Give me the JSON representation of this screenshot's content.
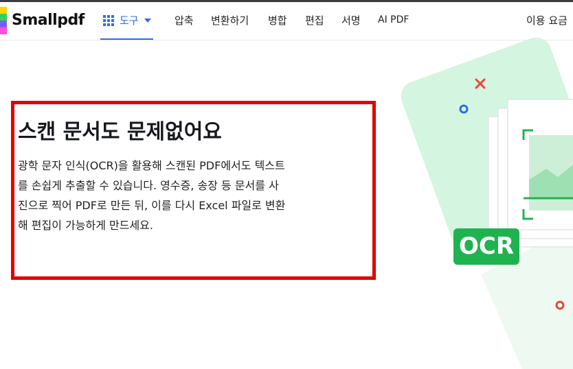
{
  "brand": {
    "name": "Smallpdf"
  },
  "nav": {
    "tools_label": "도구",
    "items": [
      "압축",
      "변환하기",
      "병합",
      "편집",
      "서명",
      "AI PDF"
    ],
    "pricing_label": "이용 요금"
  },
  "hero": {
    "headline": "스캔 문서도 문제없어요",
    "description_lines": [
      "광학 문자 인식(OCR)을 활용해 스캔된 PDF에서도 텍스트",
      "를 손쉽게 추출할 수 있습니다. 영수증, 송장 등 문서를 사",
      "진으로 찍어 PDF로 만든 뒤, 이를 다시 Excel 파일로 변환",
      "해 편집이 가능하게 만드세요."
    ],
    "badge_label": "OCR"
  },
  "colors": {
    "accent": "#2f6be8",
    "highlight_border": "#e00000",
    "ocr_green": "#1fb34f",
    "illustration_mint": "#d4f5df"
  }
}
